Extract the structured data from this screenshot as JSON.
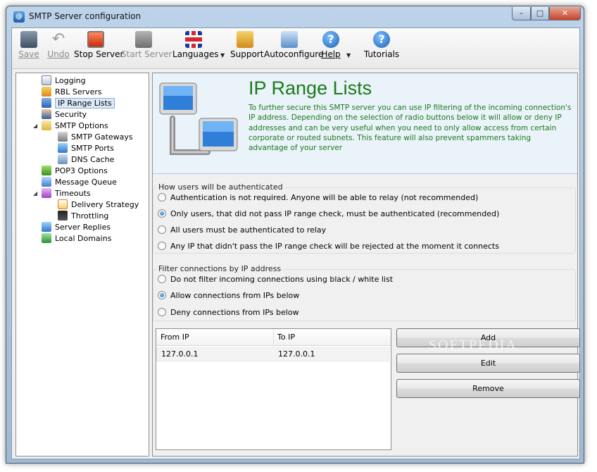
{
  "window": {
    "title": "SMTP Server configuration",
    "controls": {
      "minimize": "–",
      "maximize": "□",
      "close": "✕"
    }
  },
  "toolbar": {
    "buttons": [
      {
        "label": "Save",
        "icon": "save-icon",
        "enabled": false
      },
      {
        "label": "Undo",
        "icon": "undo-icon",
        "enabled": false
      },
      {
        "label": "Stop Server",
        "icon": "stop-icon",
        "enabled": true
      },
      {
        "label": "Start Server",
        "icon": "start-icon",
        "enabled": false
      },
      {
        "label": "Languages",
        "icon": "uk-flag-icon",
        "enabled": true
      },
      {
        "label": "Support",
        "icon": "support-icon",
        "enabled": true
      },
      {
        "label": "Autoconfigure",
        "icon": "house-icon",
        "enabled": true
      },
      {
        "label": "Help",
        "icon": "help-icon",
        "enabled": true
      },
      {
        "label": "Tutorials",
        "icon": "help-icon",
        "enabled": true
      }
    ],
    "help_glyph": "?",
    "dropdown_glyph": "▼",
    "undo_glyph": "↶"
  },
  "tree": {
    "items": [
      {
        "label": "Logging",
        "icon": "log-icon"
      },
      {
        "label": "RBL Servers",
        "icon": "rbl-icon"
      },
      {
        "label": "IP Range Lists",
        "icon": "monitor-icon",
        "selected": true
      },
      {
        "label": "Security",
        "icon": "user-icon"
      },
      {
        "label": "SMTP Options",
        "icon": "envelope-icon",
        "expanded": true
      },
      {
        "label": "SMTP Gateways",
        "icon": "gateway-icon"
      },
      {
        "label": "SMTP Ports",
        "icon": "ports-icon"
      },
      {
        "label": "DNS Cache",
        "icon": "dns-icon"
      },
      {
        "label": "POP3 Options",
        "icon": "pop3-icon"
      },
      {
        "label": "Message Queue",
        "icon": "queue-icon"
      },
      {
        "label": "Timeouts",
        "icon": "clock-icon",
        "expanded": true
      },
      {
        "label": "Delivery Strategy",
        "icon": "calendar-icon"
      },
      {
        "label": "Throttling",
        "icon": "traffic-light-icon"
      },
      {
        "label": "Server Replies",
        "icon": "replies-icon"
      },
      {
        "label": "Local Domains",
        "icon": "domains-icon"
      }
    ],
    "expander_glyph": "◢"
  },
  "banner": {
    "title": "IP Range Lists",
    "description": "To further secure this SMTP server you can use IP filtering of the incoming connection's IP address. Depending on the selection of radio buttons below it will allow or deny IP addresses and can be very useful when you need to only allow access from certain corporate or routed subnets. This feature will also prevent spammers taking advantage of your server"
  },
  "auth_group": {
    "title": "How users will be authenticated",
    "options": [
      {
        "label": "Authentication is not required. Anyone will be able to relay (not recommended)",
        "checked": false
      },
      {
        "label": "Only users, that did not pass IP range check, must be authenticated (recommended)",
        "checked": true
      },
      {
        "label": "All users must be authenticated to relay",
        "checked": false
      },
      {
        "label": "Any IP that didn't pass the IP range check will be rejected at the moment it connects",
        "checked": false
      }
    ]
  },
  "filter_group": {
    "title": "Filter connections by IP address",
    "options": [
      {
        "label": "Do not filter incoming connections using black / white list",
        "checked": false
      },
      {
        "label": "Allow connections from IPs below",
        "checked": true
      },
      {
        "label": "Deny connections from IPs below",
        "checked": false
      }
    ]
  },
  "ip_list": {
    "columns": [
      "From IP",
      "To IP"
    ],
    "rows": [
      [
        "127.0.0.1",
        "127.0.0.1"
      ]
    ]
  },
  "actions": {
    "add": "Add",
    "edit": "Edit",
    "remove": "Remove"
  },
  "watermark": "SOFTPEDIA",
  "colors": {
    "banner_text": "#1a7b1a",
    "selection": "#dbe8f7"
  }
}
